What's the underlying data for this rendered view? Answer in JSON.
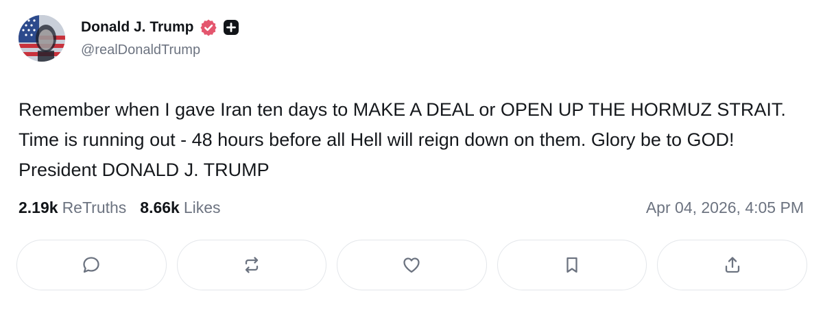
{
  "post": {
    "author": {
      "display_name": "Donald J. Trump",
      "handle": "@realDonaldTrump",
      "verified_icon": "verified-check-badge-icon",
      "verified_color": "#e4566e",
      "plus_icon": "plus-badge-icon"
    },
    "text": "Remember when I gave Iran ten days to MAKE A DEAL or OPEN UP THE HORMUZ STRAIT. Time is running out - 48 hours before all Hell will reign down on them. Glory be to GOD! President DONALD J. TRUMP",
    "stats": {
      "retruths_count": "2.19k",
      "retruths_label": "ReTruths",
      "likes_count": "8.66k",
      "likes_label": "Likes"
    },
    "timestamp": "Apr 04, 2026, 4:05 PM",
    "actions": [
      {
        "icon": "reply-icon"
      },
      {
        "icon": "retruth-icon"
      },
      {
        "icon": "like-heart-icon"
      },
      {
        "icon": "bookmark-icon"
      },
      {
        "icon": "share-upload-icon"
      }
    ]
  }
}
